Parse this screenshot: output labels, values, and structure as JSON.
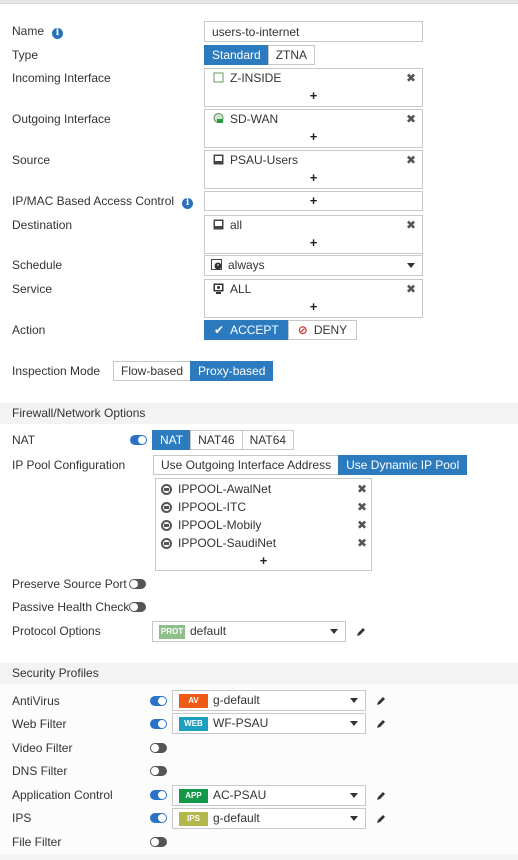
{
  "form": {
    "name": {
      "label": "Name",
      "value": "users-to-internet"
    },
    "type": {
      "label": "Type",
      "options": [
        "Standard",
        "ZTNA"
      ],
      "selected": "Standard"
    },
    "incoming_interface": {
      "label": "Incoming Interface",
      "items": [
        "Z-INSIDE"
      ],
      "icon": "interface-port-icon"
    },
    "outgoing_interface": {
      "label": "Outgoing Interface",
      "items": [
        "SD-WAN"
      ],
      "icon": "sdwan-icon"
    },
    "source": {
      "label": "Source",
      "items": [
        "PSAU-Users"
      ],
      "icon": "address-icon"
    },
    "ip_mac_access": {
      "label": "IP/MAC Based Access Control",
      "items": []
    },
    "destination": {
      "label": "Destination",
      "items": [
        "all"
      ],
      "icon": "address-icon"
    },
    "schedule": {
      "label": "Schedule",
      "value": "always",
      "icon": "schedule-icon"
    },
    "service": {
      "label": "Service",
      "items": [
        "ALL"
      ],
      "icon": "service-icon"
    },
    "action": {
      "label": "Action",
      "options": [
        "ACCEPT",
        "DENY"
      ],
      "selected": "ACCEPT"
    },
    "inspection_mode": {
      "label": "Inspection Mode",
      "options": [
        "Flow-based",
        "Proxy-based"
      ],
      "selected": "Proxy-based"
    }
  },
  "firewall_options": {
    "title": "Firewall/Network Options",
    "nat": {
      "label": "NAT",
      "enabled": true,
      "options": [
        "NAT",
        "NAT46",
        "NAT64"
      ],
      "selected": "NAT"
    },
    "ip_pool_config": {
      "label": "IP Pool Configuration",
      "options": [
        "Use Outgoing Interface Address",
        "Use Dynamic IP Pool"
      ],
      "selected": "Use Dynamic IP Pool",
      "pools": [
        "IPPOOL-AwalNet",
        "IPPOOL-ITC",
        "IPPOOL-Mobily",
        "IPPOOL-SaudiNet"
      ]
    },
    "preserve_source_port": {
      "label": "Preserve Source Port",
      "enabled": false
    },
    "passive_health_check": {
      "label": "Passive Health Check",
      "enabled": false
    },
    "protocol_options": {
      "label": "Protocol Options",
      "badge": "PROT",
      "value": "default",
      "badge_color": "#8fbf8a"
    }
  },
  "security_profiles": {
    "title": "Security Profiles",
    "items": [
      {
        "label": "AntiVirus",
        "enabled": true,
        "badge": "AV",
        "badge_color": "#ef5a16",
        "value": "g-default"
      },
      {
        "label": "Web Filter",
        "enabled": true,
        "badge": "WEB",
        "badge_color": "#1da0c0",
        "value": "WF-PSAU"
      },
      {
        "label": "Video Filter",
        "enabled": false
      },
      {
        "label": "DNS Filter",
        "enabled": false
      },
      {
        "label": "Application Control",
        "enabled": true,
        "badge": "APP",
        "badge_color": "#13984a",
        "value": "AC-PSAU"
      },
      {
        "label": "IPS",
        "enabled": true,
        "badge": "IPS",
        "badge_color": "#b4b84a",
        "value": "g-default"
      },
      {
        "label": "File Filter",
        "enabled": false
      }
    ]
  },
  "colors": {
    "accent": "#2d7bbf",
    "deny": "#d0302c"
  }
}
